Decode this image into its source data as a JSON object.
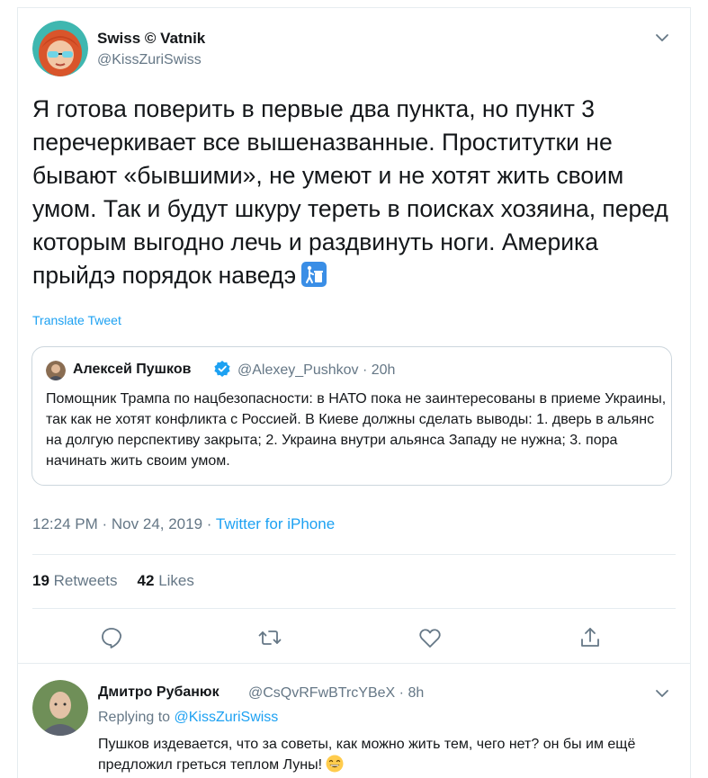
{
  "tweet": {
    "author_name": "Swiss © Vatnik",
    "author_handle": "@KissZuriSwiss",
    "text": "Я готова поверить в первые два пункта, но пункт 3 перечеркивает все вышеназванные. Проститутки не бывают «бывшими», не умеют и не хотят жить своим умом. Так и будут шкуру тереть в поисках хозяина, перед которым выгодно лечь и раздвинуть ноги. Америка прыйдэ порядок наведэ",
    "emoji_icon": "trash-can-icon",
    "translate_label": "Translate Tweet",
    "time": "12:24 PM",
    "date": "Nov 24, 2019",
    "source": "Twitter for iPhone",
    "separator": "·",
    "retweets_count": "19",
    "retweets_label": "Retweets",
    "likes_count": "42",
    "likes_label": "Likes"
  },
  "quoted": {
    "author_name": "Алексей Пушков",
    "verified_icon": "verified-badge-icon",
    "author_handle": "@Alexey_Pushkov",
    "time": "· 20h",
    "text": "Помощник Трампа по нацбезопасности: в НАТО пока не заинтересованы в приеме Украины, так как не хотят конфликта с Россией. В Киеве должны сделать выводы: 1. дверь в альянс на долгую перспективу закрыта; 2. Украина внутри альянса Западу не нужна; 3. пора начинать жить своим умом."
  },
  "actions": {
    "icons": [
      "reply-icon",
      "retweet-icon",
      "like-icon",
      "share-icon"
    ]
  },
  "reply": {
    "author_name": "Дмитро Рубанюк",
    "author_handle": "@CsQvRFwBTrcYBeX · 8h",
    "replying_prefix": "Replying to",
    "replying_mention": "@KissZuriSwiss",
    "text": "Пушков издевается, что за советы, как можно жить тем, чего нет? он бы им ещё предложил греться теплом Луны!",
    "emoji_icon": "grinning-face-icon"
  },
  "colors": {
    "accent": "#1da1f2",
    "secondary_text": "#657786",
    "primary_text": "#14171a",
    "border": "#e6ecf0"
  }
}
